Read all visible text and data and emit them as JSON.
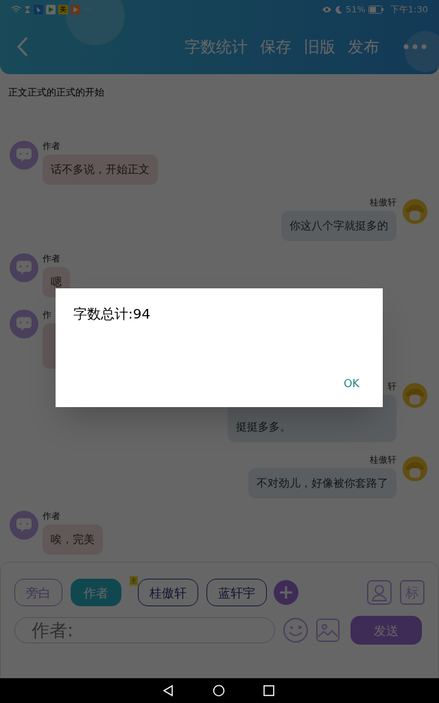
{
  "status_bar": {
    "app_badge": "美",
    "overflow": "···",
    "battery": "51%",
    "time": "下午1:30"
  },
  "header": {
    "actions": [
      "字数统计",
      "保存",
      "旧版",
      "发布"
    ]
  },
  "doc_title": "正文正式的正式的开始",
  "messages": [
    {
      "kind": "incoming",
      "author": "作者",
      "text": "话不多说，开始正文"
    },
    {
      "kind": "outgoing",
      "author": "桂傲轩",
      "text": "你这八个字就挺多的"
    },
    {
      "kind": "incoming",
      "author": "作者",
      "text": "嗯"
    },
    {
      "kind": "incoming_covered",
      "author": "作"
    },
    {
      "kind": "outgoing_covered",
      "author": "轩",
      "text": "挺挺多多。"
    },
    {
      "kind": "outgoing",
      "author": "桂傲轩",
      "text": "不对劲儿，好像被你套路了"
    },
    {
      "kind": "incoming",
      "author": "作者",
      "text": "唉，完美"
    }
  ],
  "roles": [
    {
      "label": "旁白",
      "selected": false,
      "kind": "narrator"
    },
    {
      "label": "作者",
      "selected": true,
      "kind": "character"
    },
    {
      "label": "桂傲轩",
      "selected": false,
      "kind": "character",
      "badge": "主"
    },
    {
      "label": "蓝轩宇",
      "selected": false,
      "kind": "character"
    }
  ],
  "tag_button": "标",
  "input": {
    "placeholder": "作者:"
  },
  "send_button": "发送",
  "dialog": {
    "message": "字数总计:94",
    "button": "OK"
  }
}
